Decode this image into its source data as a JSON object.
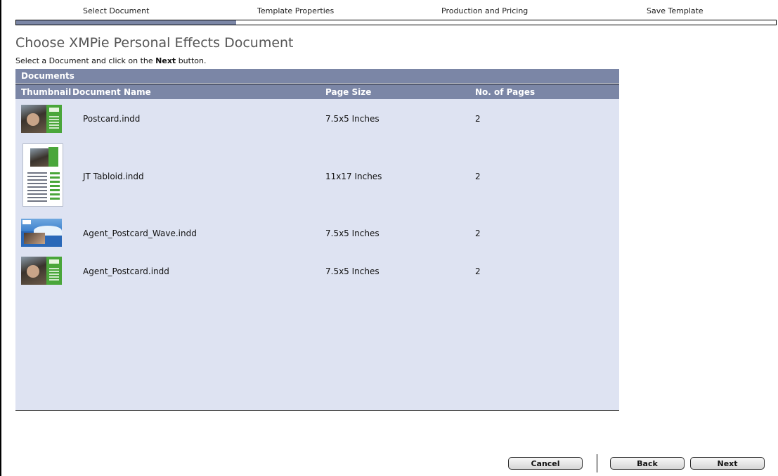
{
  "wizard": {
    "steps": [
      "Select Document",
      "Template Properties",
      "Production and Pricing",
      "Save Template"
    ],
    "progress_fraction": 0.29
  },
  "page": {
    "title": "Choose XMPie Personal Effects Document",
    "instruction_prefix": "Select a Document and click on the ",
    "instruction_bold": "Next",
    "instruction_suffix": " button."
  },
  "documents": {
    "panel_title": "Documents",
    "columns": [
      "Thumbnail",
      "Document Name",
      "Page Size",
      "No. of Pages"
    ],
    "rows": [
      {
        "name": "Postcard.indd",
        "page_size": "7.5x5 Inches",
        "pages": "2",
        "thumbnail": "postcard-thumbnail"
      },
      {
        "name": "JT Tabloid.indd",
        "page_size": "11x17 Inches",
        "pages": "2",
        "thumbnail": "tabloid-thumbnail"
      },
      {
        "name": "Agent_Postcard_Wave.indd",
        "page_size": "7.5x5 Inches",
        "pages": "2",
        "thumbnail": "wave-postcard-thumbnail"
      },
      {
        "name": "Agent_Postcard.indd",
        "page_size": "7.5x5 Inches",
        "pages": "2",
        "thumbnail": "postcard-thumbnail"
      }
    ]
  },
  "buttons": {
    "cancel": "Cancel",
    "back": "Back",
    "next": "Next"
  },
  "colors": {
    "header": "#7b86a6",
    "panel": "#dee3f2",
    "accent_green": "#4aa63a"
  }
}
